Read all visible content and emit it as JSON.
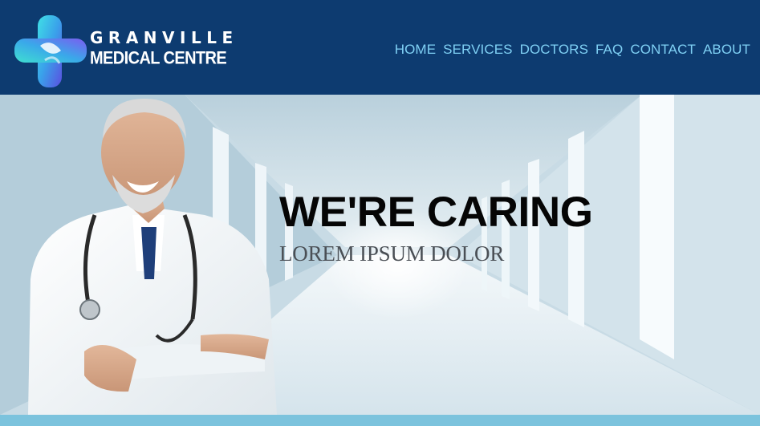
{
  "brand": {
    "line1": "GRANVILLE",
    "line2": "MEDICAL CENTRE",
    "logo_icon": "medical-cross-icon",
    "colors": {
      "header_bg": "#0d3b70",
      "nav_link": "#7fd0f4",
      "footer_strip": "#7cc3dd"
    }
  },
  "nav": {
    "items": [
      {
        "label": "HOME"
      },
      {
        "label": "SERVICES"
      },
      {
        "label": "DOCTORS"
      },
      {
        "label": "FAQ"
      },
      {
        "label": "CONTACT"
      },
      {
        "label": "ABOUT"
      }
    ]
  },
  "hero": {
    "title": "WE'RE CARING",
    "subtitle": "LOREM IPSUM DOLOR",
    "image": "doctor-in-hospital-corridor"
  }
}
